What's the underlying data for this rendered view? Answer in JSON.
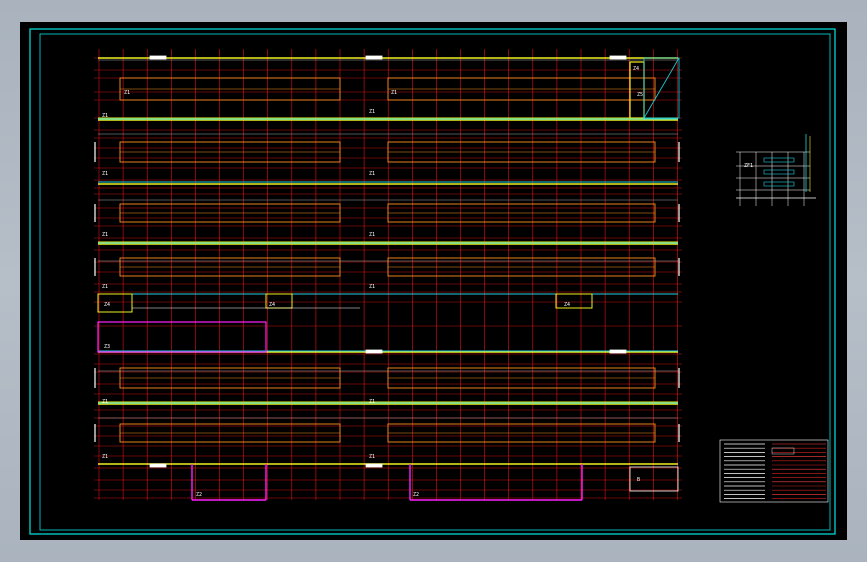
{
  "canvas": {
    "background": "#000000",
    "frame_color": "#00e5e5",
    "grid_color": "#e01010",
    "wall_color": "#f0f020",
    "beam_color": "#ff9020",
    "pipe_color": "#ff20ff",
    "duct_color": "#20d0e0"
  },
  "labels": {
    "row_1": "Z1",
    "row_1b": "Z1",
    "row_2": "Z1",
    "row_2b": "Z1",
    "row_3": "Z1",
    "row_3b": "Z1",
    "row_4": "Z1",
    "row_4b": "Z1",
    "row_5": "Z1",
    "row_5b": "Z1",
    "row_6": "Z1",
    "row_6b": "Z1",
    "row_7": "Z1",
    "row_7b": "Z1",
    "mid_a": "Z4",
    "mid_b": "Z4",
    "mid_c": "Z4",
    "mid_d": "Z3",
    "bottom_a": "Z2",
    "bottom_b": "Z2",
    "corner_a": "Z4",
    "corner_b": "Z5",
    "corner_c": "ZF1",
    "stair": "B"
  }
}
